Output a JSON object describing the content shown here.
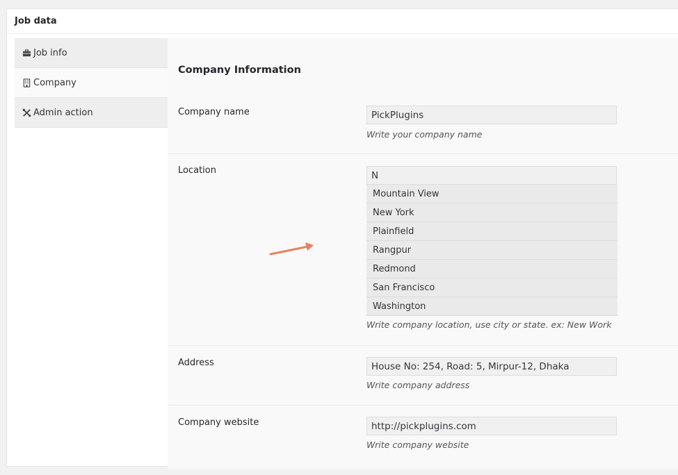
{
  "metabox": {
    "title": "Job data"
  },
  "tabs": [
    {
      "label": "Job info",
      "icon": "briefcase-icon"
    },
    {
      "label": "Company",
      "icon": "building-icon"
    },
    {
      "label": "Admin action",
      "icon": "tools-icon"
    }
  ],
  "section": {
    "title": "Company Information"
  },
  "fields": {
    "company_name": {
      "label": "Company name",
      "value": "PickPlugins",
      "hint": "Write your company name"
    },
    "location": {
      "label": "Location",
      "value": "N",
      "hint": "Write company location, use city or state. ex: New Work",
      "suggestions": [
        "Mountain View",
        "New York",
        "Plainfield",
        "Rangpur",
        "Redmond",
        "San Francisco",
        "Washington"
      ]
    },
    "address": {
      "label": "Address",
      "value": "House No: 254, Road: 5, Mirpur-12, Dhaka",
      "hint": "Write company address"
    },
    "website": {
      "label": "Company website",
      "value": "http://pickplugins.com",
      "hint": "Write company website"
    }
  },
  "colors": {
    "arrow": "#e8825e",
    "tab_bg": "#eeeeee",
    "content_bg": "#f9f9f9"
  }
}
